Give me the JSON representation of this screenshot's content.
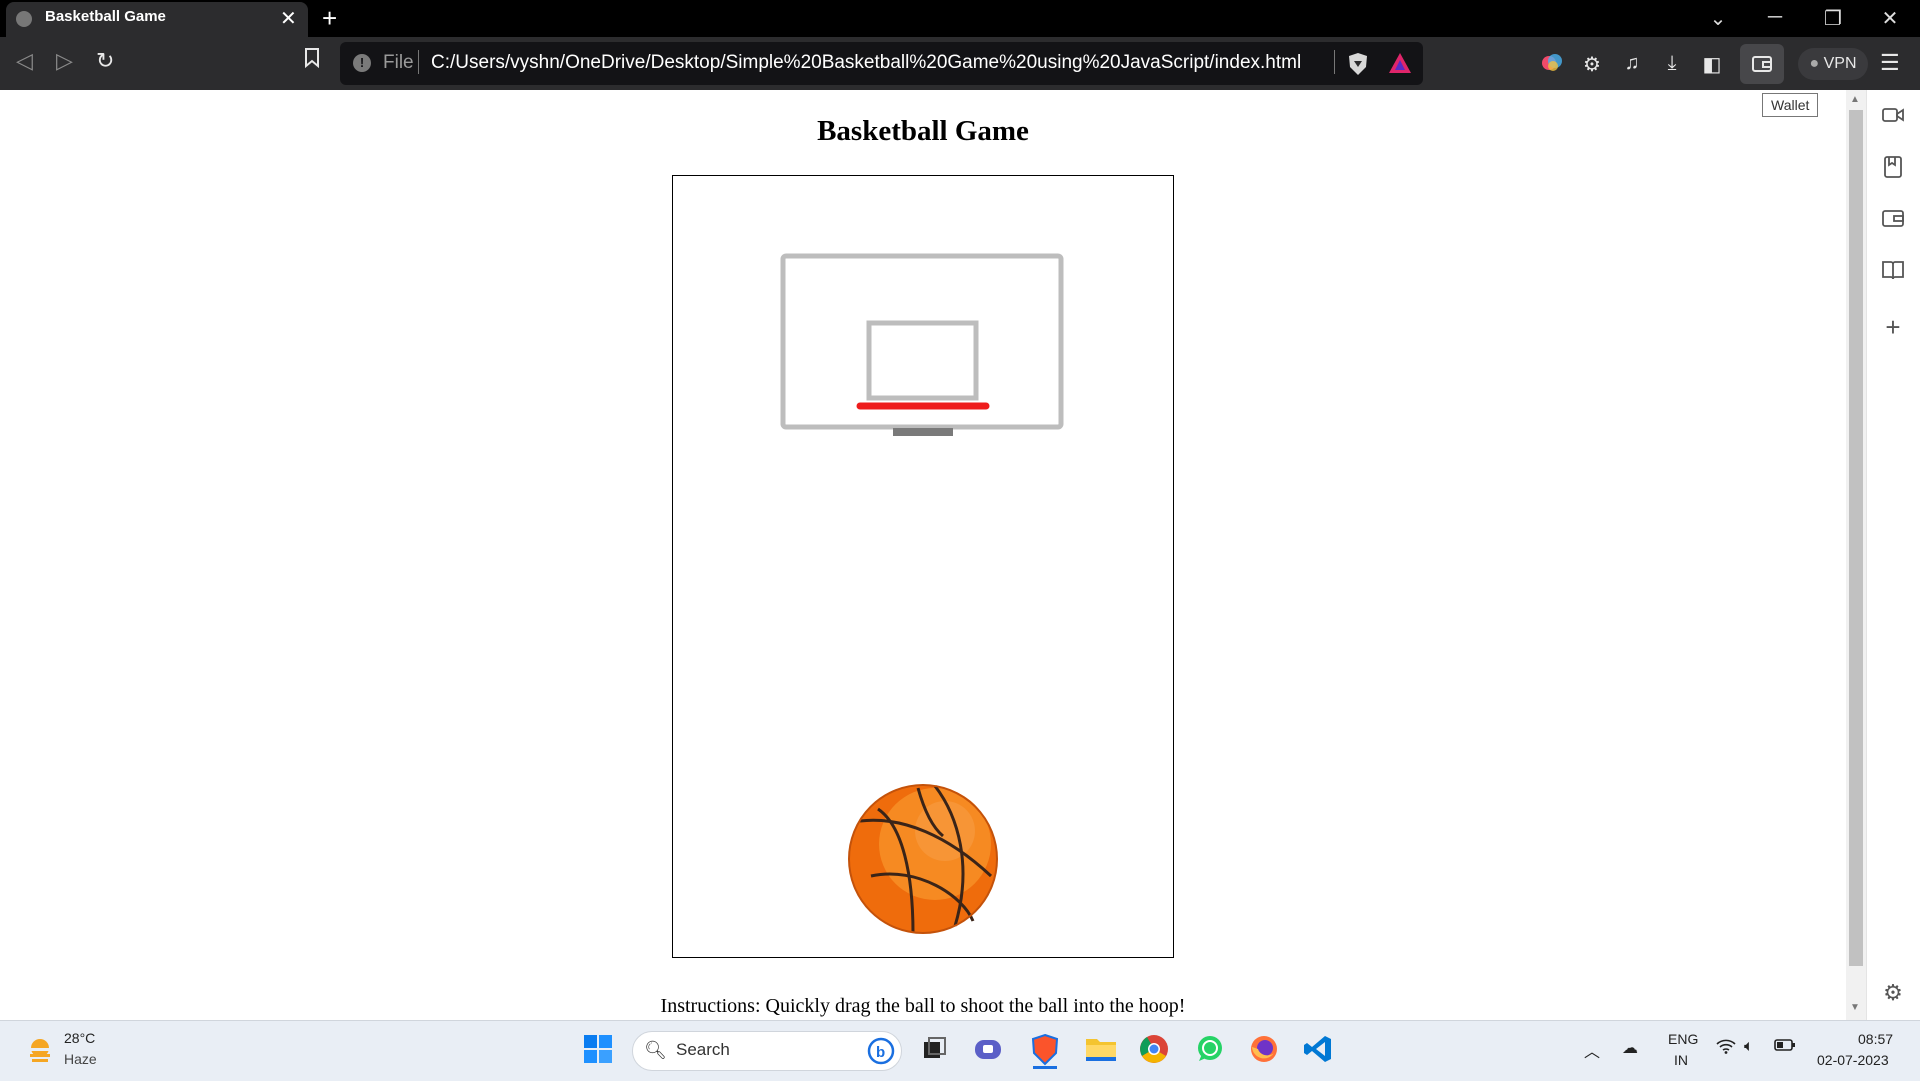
{
  "browser": {
    "tab_title": "Basketball Game",
    "url_scheme": "File",
    "url": "C:/Users/vyshn/OneDrive/Desktop/Simple%20Basketball%20Game%20using%20JavaScript/index.html",
    "vpn_label": "VPN",
    "wallet_tooltip": "Wallet"
  },
  "page": {
    "title": "Basketball Game",
    "instructions": "Instructions: Quickly drag the ball to shoot the ball into the hoop!"
  },
  "game": {
    "ball_color": "#f0780f",
    "rim_color": "#ee1c1c",
    "backboard_color": "#bdbdbd"
  },
  "taskbar": {
    "weather_temp": "28°C",
    "weather_desc": "Haze",
    "search_label": "Search",
    "lang_top": "ENG",
    "lang_bottom": "IN",
    "time": "08:57",
    "date": "02-07-2023"
  }
}
